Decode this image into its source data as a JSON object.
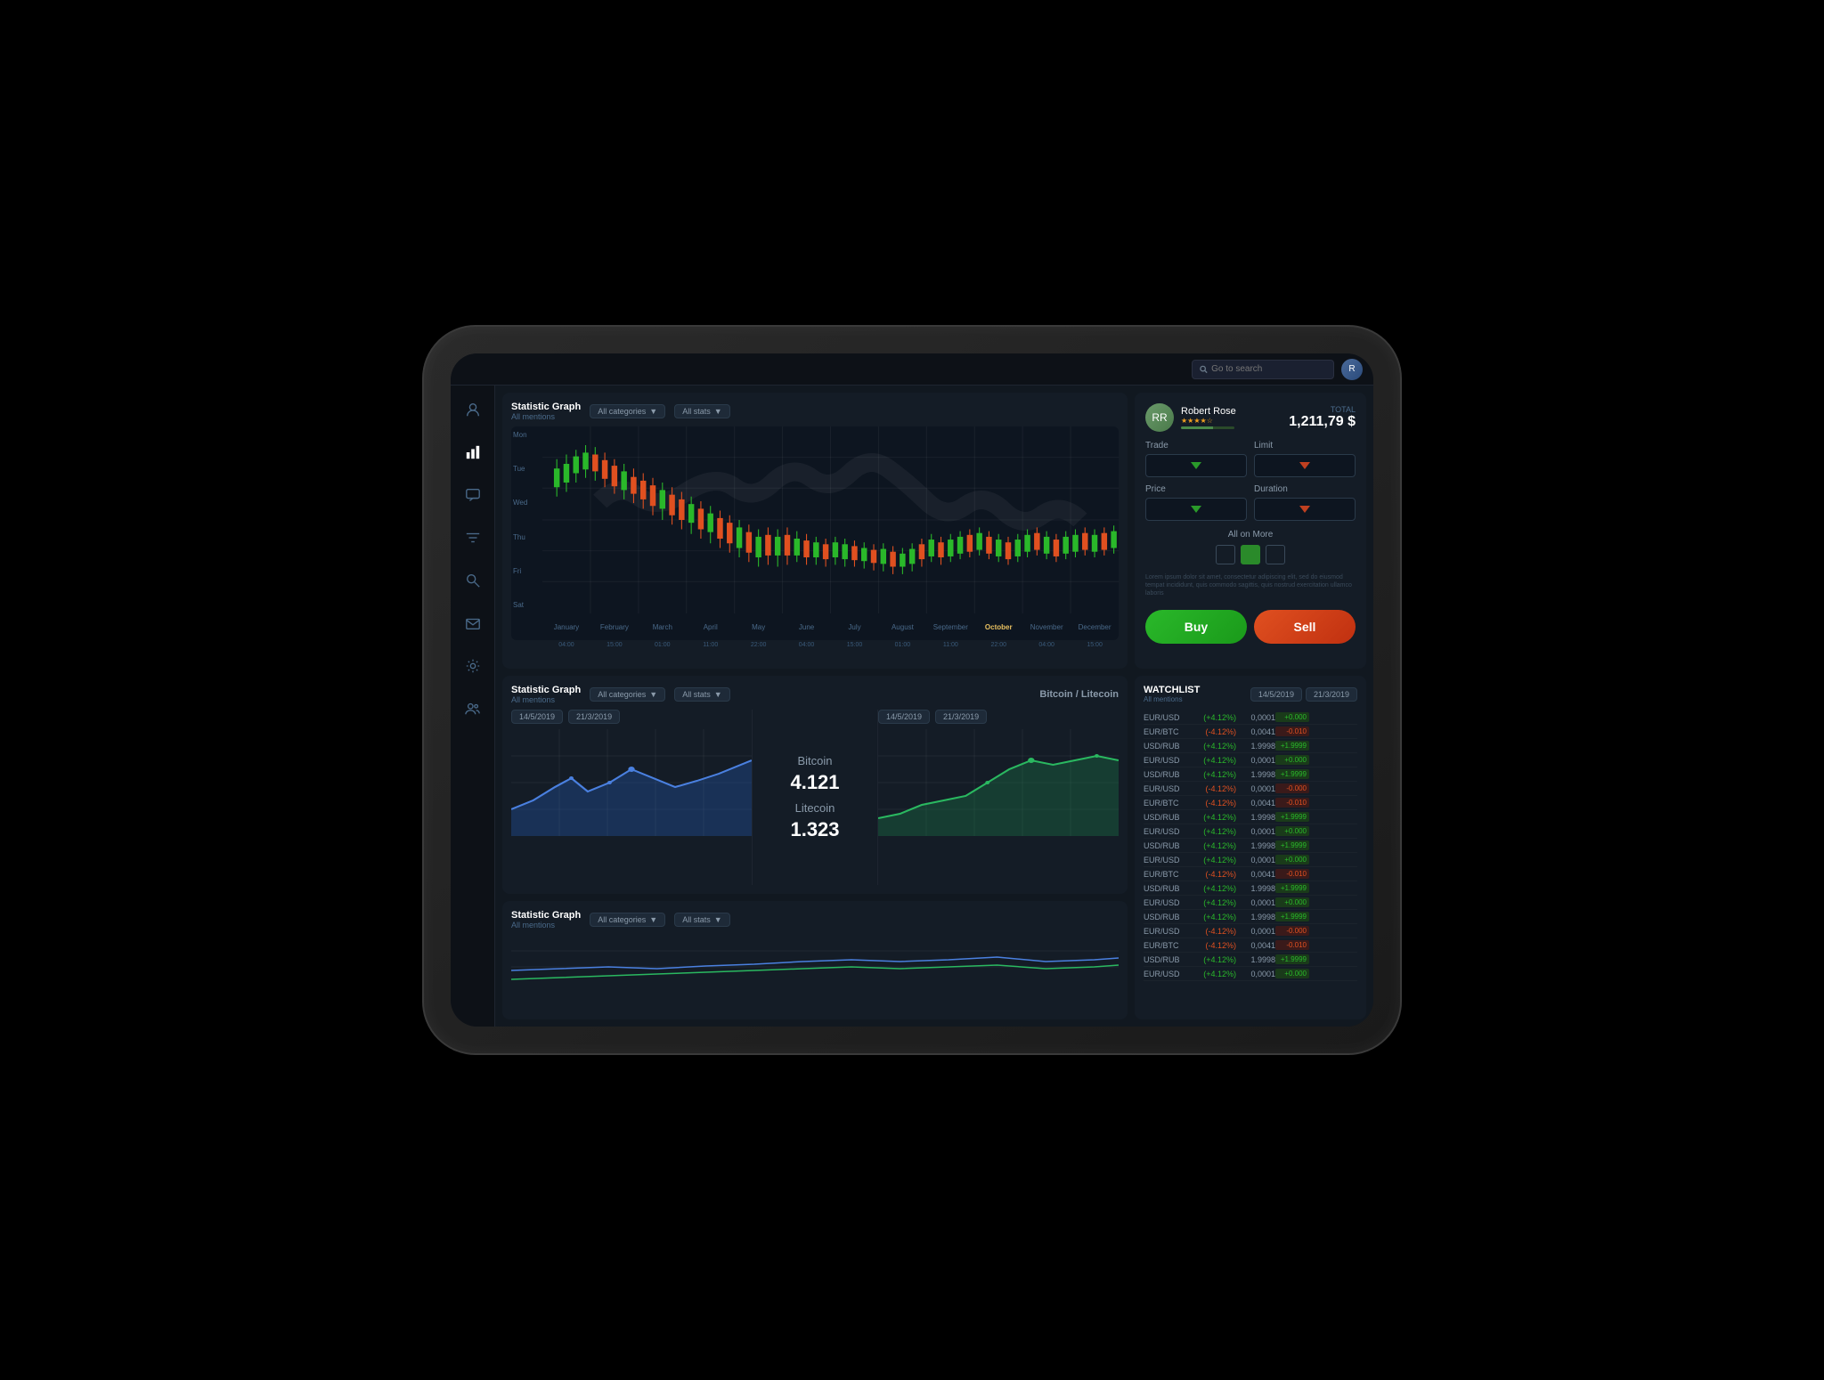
{
  "topBar": {
    "searchPlaceholder": "Go to search",
    "userInitial": "R"
  },
  "sidebar": {
    "icons": [
      {
        "name": "user-icon",
        "symbol": "👤",
        "active": false
      },
      {
        "name": "chart-icon",
        "symbol": "📊",
        "active": true
      },
      {
        "name": "chat-icon",
        "symbol": "💬",
        "active": false
      },
      {
        "name": "filter-icon",
        "symbol": "⚡",
        "active": false
      },
      {
        "name": "search-icon",
        "symbol": "🔍",
        "active": false
      },
      {
        "name": "mail-icon",
        "symbol": "✉",
        "active": false
      },
      {
        "name": "settings-icon",
        "symbol": "⚙",
        "active": false
      },
      {
        "name": "users-icon",
        "symbol": "👥",
        "active": false
      }
    ]
  },
  "mainChart": {
    "title": "Statistic Graph",
    "subtitle": "All mentions",
    "dropdown1": "All categories",
    "dropdown2": "All stats",
    "xLabels": [
      "January",
      "February",
      "March",
      "April",
      "May",
      "June",
      "July",
      "August",
      "September",
      "October",
      "November",
      "December"
    ],
    "xSubLabels": [
      "04:00",
      "15:00",
      "01:00",
      "11:00",
      "22:00",
      "04:00",
      "15:00",
      "01:00",
      "11:00",
      "22:00",
      "04:00",
      "15:00"
    ],
    "yLabels": [
      "Mon",
      "Tue",
      "Wed",
      "Thu",
      "Fri",
      "Sat"
    ]
  },
  "tradePanel": {
    "userName": "Robert Rose",
    "userStars": "★★★★☆",
    "totalLabel": "TOTAL",
    "totalValue": "1,211,79 $",
    "tradeLabel": "Trade",
    "limitLabel": "Limit",
    "priceLabel": "Price",
    "durationLabel": "Duration",
    "allOnMoreLabel": "All on More",
    "disclaimerText": "Lorem ipsum dolor sit amet, consectetur adipiscing elit, sed do eiusmod tempat incididunt, quis commodo sagittis, quis nostrud exercitation ullamco laboris",
    "buyLabel": "Buy",
    "sellLabel": "Sell"
  },
  "bitcoinPanel": {
    "title": "Statistic Graph",
    "subtitle": "All mentions",
    "dropdown1": "All categories",
    "dropdown2": "All stats",
    "centerTitle": "Bitcoin / Litecoin",
    "date1": "14/5/2019",
    "date2": "21/3/2019",
    "bitcoinLabel": "Bitcoin",
    "bitcoinValue": "4.121",
    "litecoinLabel": "Litecoin",
    "litecoinValue": "1.323"
  },
  "miniChart": {
    "title": "Statistic Graph",
    "subtitle": "All mentions",
    "dropdown1": "All categories",
    "dropdown2": "All stats"
  },
  "watchlist": {
    "title": "WATCHLIST",
    "date1": "14/5/2019",
    "date2": "21/3/2019",
    "subtitle": "All mentions",
    "rows": [
      {
        "pair": "EUR/USD",
        "change": "(+4.12%)",
        "positive": true,
        "price": "0,0001",
        "delta": "+0.000",
        "deltaPositive": true
      },
      {
        "pair": "EUR/BTC",
        "change": "(-4.12%)",
        "positive": false,
        "price": "0,0041",
        "delta": "-0.010",
        "deltaPositive": false
      },
      {
        "pair": "USD/RUB",
        "change": "(+4.12%)",
        "positive": true,
        "price": "1.9998",
        "delta": "+1.9999",
        "deltaPositive": true
      },
      {
        "pair": "EUR/USD",
        "change": "(+4.12%)",
        "positive": true,
        "price": "0,0001",
        "delta": "+0.000",
        "deltaPositive": true
      },
      {
        "pair": "USD/RUB",
        "change": "(+4.12%)",
        "positive": true,
        "price": "1.9998",
        "delta": "+1.9999",
        "deltaPositive": true
      },
      {
        "pair": "EUR/USD",
        "change": "(-4.12%)",
        "positive": false,
        "price": "0,0001",
        "delta": "-0.000",
        "deltaPositive": false
      },
      {
        "pair": "EUR/BTC",
        "change": "(-4.12%)",
        "positive": false,
        "price": "0,0041",
        "delta": "-0.010",
        "deltaPositive": false
      },
      {
        "pair": "USD/RUB",
        "change": "(+4.12%)",
        "positive": true,
        "price": "1.9998",
        "delta": "+1.9999",
        "deltaPositive": true
      },
      {
        "pair": "EUR/USD",
        "change": "(+4.12%)",
        "positive": true,
        "price": "0,0001",
        "delta": "+0.000",
        "deltaPositive": true
      },
      {
        "pair": "USD/RUB",
        "change": "(+4.12%)",
        "positive": true,
        "price": "1.9998",
        "delta": "+1.9999",
        "deltaPositive": true
      },
      {
        "pair": "EUR/USD",
        "change": "(+4.12%)",
        "positive": true,
        "price": "0,0001",
        "delta": "+0.000",
        "deltaPositive": true
      },
      {
        "pair": "EUR/BTC",
        "change": "(-4.12%)",
        "positive": false,
        "price": "0,0041",
        "delta": "-0.010",
        "deltaPositive": false
      },
      {
        "pair": "USD/RUB",
        "change": "(+4.12%)",
        "positive": true,
        "price": "1.9998",
        "delta": "+1.9999",
        "deltaPositive": true
      },
      {
        "pair": "EUR/USD",
        "change": "(+4.12%)",
        "positive": true,
        "price": "0,0001",
        "delta": "+0.000",
        "deltaPositive": true
      },
      {
        "pair": "USD/RUB",
        "change": "(+4.12%)",
        "positive": true,
        "price": "1.9998",
        "delta": "+1.9999",
        "deltaPositive": true
      },
      {
        "pair": "EUR/USD",
        "change": "(-4.12%)",
        "positive": false,
        "price": "0,0001",
        "delta": "-0.000",
        "deltaPositive": false
      },
      {
        "pair": "EUR/BTC",
        "change": "(-4.12%)",
        "positive": false,
        "price": "0,0041",
        "delta": "-0.010",
        "deltaPositive": false
      },
      {
        "pair": "USD/RUB",
        "change": "(+4.12%)",
        "positive": true,
        "price": "1.9998",
        "delta": "+1.9999",
        "deltaPositive": true
      },
      {
        "pair": "EUR/USD",
        "change": "(+4.12%)",
        "positive": true,
        "price": "0,0001",
        "delta": "+0.000",
        "deltaPositive": true
      }
    ]
  },
  "colors": {
    "background": "#111820",
    "panel": "#141c26",
    "accent_green": "#2ab82a",
    "accent_red": "#e05020",
    "text_primary": "#ffffff",
    "text_secondary": "#8a9aaa",
    "border": "#1e2530"
  }
}
